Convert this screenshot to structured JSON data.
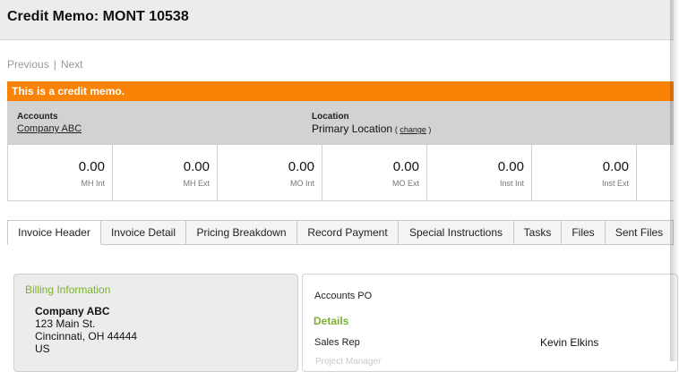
{
  "header": {
    "title": "Credit Memo: MONT 10538"
  },
  "nav": {
    "previous": "Previous",
    "separator": "|",
    "next": "Next"
  },
  "banner": {
    "text": "This is a credit memo.",
    "color": "#f98306"
  },
  "info": {
    "accounts_label": "Accounts",
    "accounts_value": "Company ABC",
    "location_label": "Location",
    "location_value": "Primary Location",
    "change_open": "(",
    "change_label": "change",
    "change_close": ")"
  },
  "stats": [
    {
      "value": "0.00",
      "caption": "MH Int"
    },
    {
      "value": "0.00",
      "caption": "MH Ext"
    },
    {
      "value": "0.00",
      "caption": "MO Int"
    },
    {
      "value": "0.00",
      "caption": "MO Ext"
    },
    {
      "value": "0.00",
      "caption": "Inst Int"
    },
    {
      "value": "0.00",
      "caption": "Inst Ext"
    }
  ],
  "tabs": [
    {
      "label": "Invoice Header",
      "active": true
    },
    {
      "label": "Invoice Detail"
    },
    {
      "label": "Pricing Breakdown"
    },
    {
      "label": "Record Payment"
    },
    {
      "label": "Special Instructions"
    },
    {
      "label": "Tasks"
    },
    {
      "label": "Files"
    },
    {
      "label": "Sent Files"
    }
  ],
  "billing": {
    "heading": "Billing Information",
    "name": "Company ABC",
    "street": "123 Main St.",
    "city": "Cincinnati, OH 44444",
    "country": "US",
    "heading_color": "#7ab030"
  },
  "details": {
    "accounts_po_label": "Accounts PO",
    "section_heading": "Details",
    "sales_rep_label": "Sales Rep",
    "sales_rep_value": "Kevin Elkins",
    "next_label_partial": "Project Manager"
  }
}
